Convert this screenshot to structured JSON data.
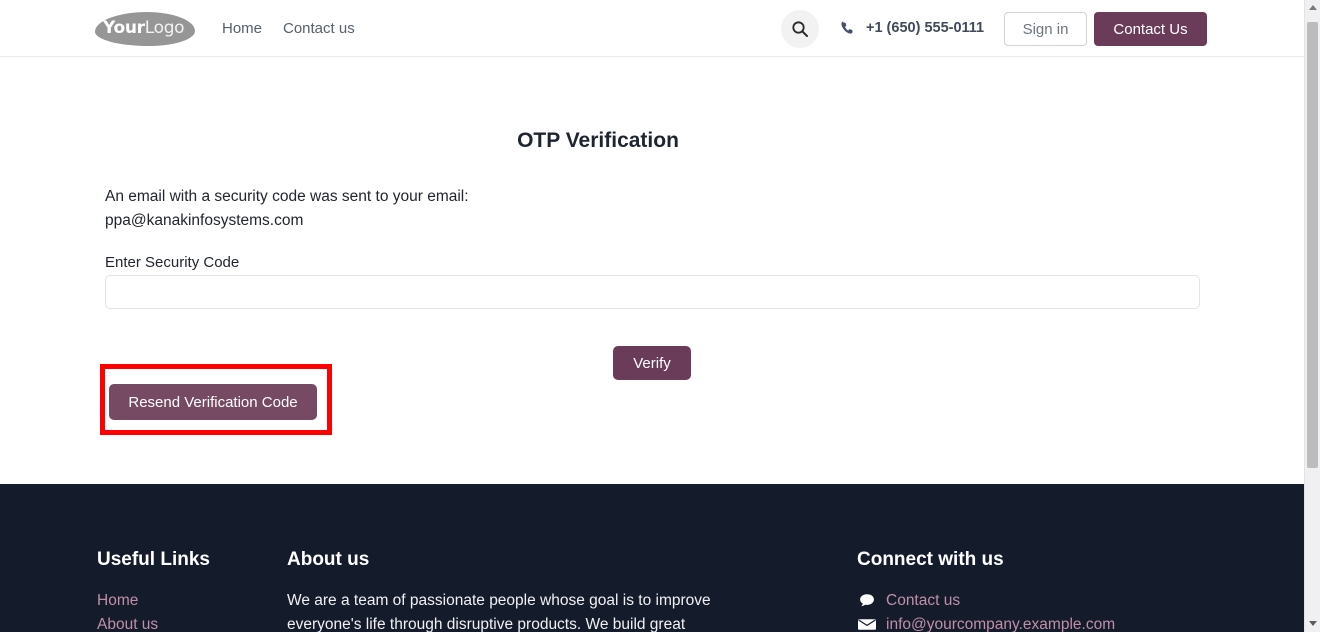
{
  "header": {
    "logo": {
      "name": "YourLogo",
      "bold_part": "Your",
      "light_part": "Logo"
    },
    "nav": [
      {
        "label": "Home"
      },
      {
        "label": "Contact us"
      }
    ],
    "search_icon": "search-icon",
    "phone_icon": "phone-icon",
    "phone": "+1 (650) 555-0111",
    "sign_in_label": "Sign in",
    "contact_us_label": "Contact Us",
    "accent_color": "#6b3c59"
  },
  "main": {
    "title": "OTP Verification",
    "sent_message": "An email with a security code was sent to your email:",
    "email": "ppa@kanakinfosystems.com",
    "code_label": "Enter Security Code",
    "code_value": "",
    "code_placeholder": "",
    "verify_label": "Verify",
    "resend_label": "Resend Verification Code",
    "highlight_color": "#fe0000"
  },
  "footer": {
    "background": "#141b2b",
    "link_color": "#c08fa8",
    "useful_links": {
      "heading": "Useful Links",
      "items": [
        {
          "label": "Home"
        },
        {
          "label": "About us"
        }
      ]
    },
    "about": {
      "heading": "About us",
      "line1": "We are a team of passionate people whose goal is to improve",
      "line2": "everyone's life through disruptive products. We build great"
    },
    "connect": {
      "heading": "Connect with us",
      "items": [
        {
          "icon": "chat-bubble-icon",
          "label": "Contact us"
        },
        {
          "icon": "envelope-icon",
          "label": "info@yourcompany.example.com"
        }
      ]
    }
  },
  "scrollbar": {
    "up_icon": "scroll-up-arrow-icon",
    "down_icon": "scroll-down-arrow-icon"
  }
}
